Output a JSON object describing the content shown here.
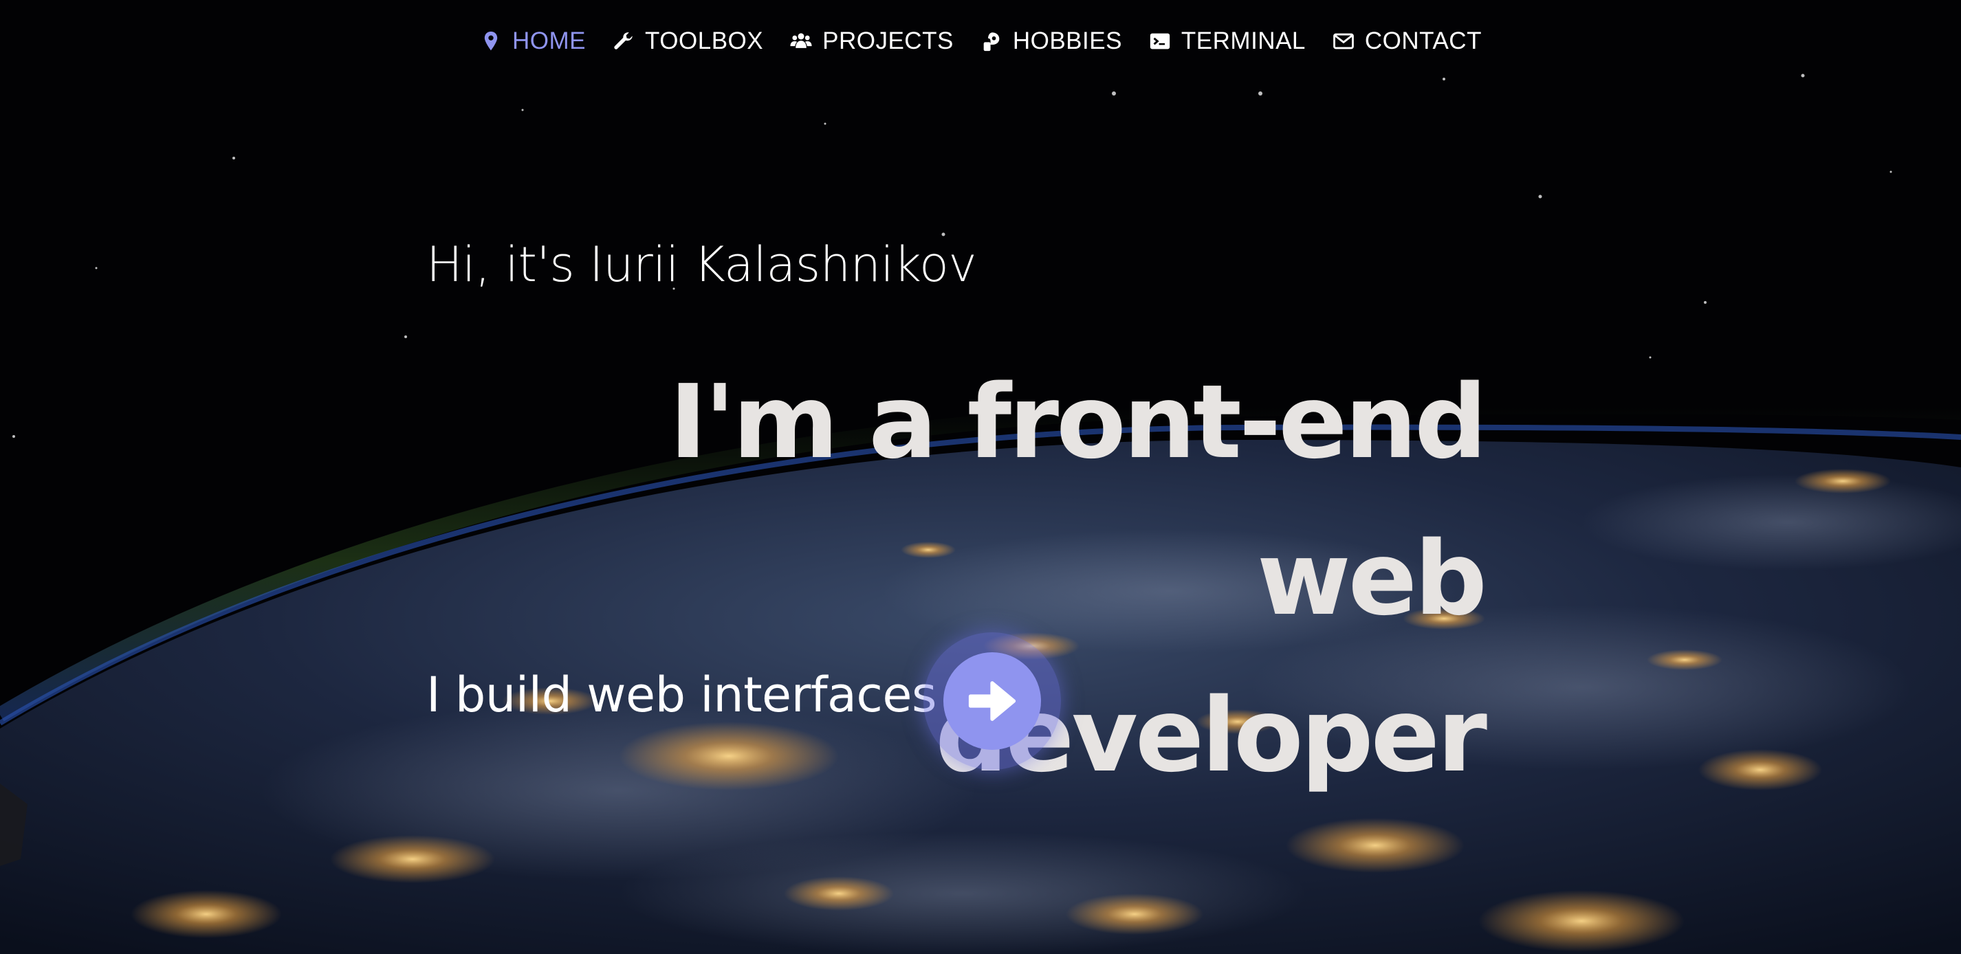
{
  "colors": {
    "accent": "#8f94ef",
    "nav_text": "#ffffff",
    "headline_text": "#e7e4e2",
    "background": "#000000"
  },
  "background_image": "night-earth-from-space",
  "nav": {
    "items": [
      {
        "label": "HOME",
        "icon": "map-pin-icon",
        "active": true
      },
      {
        "label": "TOOLBOX",
        "icon": "wrench-icon",
        "active": false
      },
      {
        "label": "PROJECTS",
        "icon": "users-icon",
        "active": false
      },
      {
        "label": "HOBBIES",
        "icon": "hobbies-icon",
        "active": false
      },
      {
        "label": "TERMINAL",
        "icon": "terminal-icon",
        "active": false
      },
      {
        "label": "CONTACT",
        "icon": "envelope-icon",
        "active": false
      }
    ]
  },
  "hero": {
    "greeting": "Hi, it's Iurii Kalashnikov",
    "headline_line1": "I'm a front-end web",
    "headline_line2": "developer",
    "tagline": "I build web interfaces",
    "cta_icon": "arrow-right-icon"
  }
}
